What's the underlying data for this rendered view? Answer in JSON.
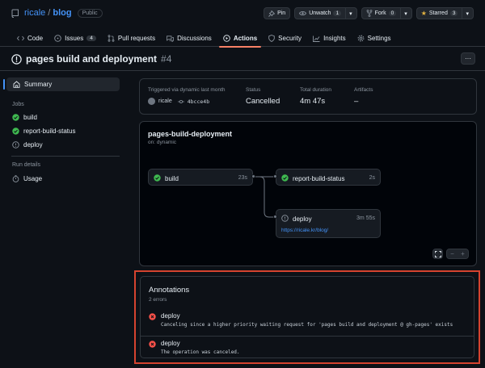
{
  "repo": {
    "owner": "ricale",
    "name": "blog",
    "visibility": "Public"
  },
  "header_buttons": {
    "pin": "Pin",
    "unwatch": "Unwatch",
    "unwatch_count": "1",
    "fork": "Fork",
    "fork_count": "0",
    "starred": "Starred",
    "star_count": "3"
  },
  "tabs": [
    {
      "label": "Code",
      "icon": "code-icon"
    },
    {
      "label": "Issues",
      "count": "4",
      "icon": "issue-icon"
    },
    {
      "label": "Pull requests",
      "icon": "pull-request-icon"
    },
    {
      "label": "Discussions",
      "icon": "discussion-icon"
    },
    {
      "label": "Actions",
      "icon": "play-icon",
      "active": true
    },
    {
      "label": "Security",
      "icon": "shield-icon"
    },
    {
      "label": "Insights",
      "icon": "graph-icon"
    },
    {
      "label": "Settings",
      "icon": "gear-icon"
    }
  ],
  "run": {
    "title": "pages build and deployment",
    "number": "#4"
  },
  "sidebar": {
    "summary": "Summary",
    "jobs_heading": "Jobs",
    "jobs": [
      {
        "label": "build",
        "status": "success"
      },
      {
        "label": "report-build-status",
        "status": "success"
      },
      {
        "label": "deploy",
        "status": "cancelled"
      }
    ],
    "run_details_heading": "Run details",
    "usage": "Usage"
  },
  "summary": {
    "trigger_text": "Triggered via dynamic last month",
    "actor": "ricale",
    "commit": "4bcce4b",
    "status_label": "Status",
    "status_value": "Cancelled",
    "duration_label": "Total duration",
    "duration_value": "4m 47s",
    "artifacts_label": "Artifacts",
    "artifacts_value": "–"
  },
  "workflow": {
    "name": "pages-build-deployment",
    "trigger": "on: dynamic",
    "jobs": {
      "build": {
        "label": "build",
        "time": "23s"
      },
      "report": {
        "label": "report-build-status",
        "time": "2s"
      },
      "deploy": {
        "label": "deploy",
        "time": "3m 55s",
        "url": "https://ricale.kr/blog/"
      }
    }
  },
  "annotations": {
    "title": "Annotations",
    "count": "2 errors",
    "items": [
      {
        "title": "deploy",
        "message": "Canceling since a higher priority waiting request for 'pages build and deployment @ gh-pages' exists"
      },
      {
        "title": "deploy",
        "message": "The operation was canceled."
      }
    ]
  },
  "colors": {
    "success": "#3fb950",
    "error": "#f85149",
    "link": "#4493f8",
    "active_tab": "#f78166",
    "highlight": "#d5432f"
  }
}
